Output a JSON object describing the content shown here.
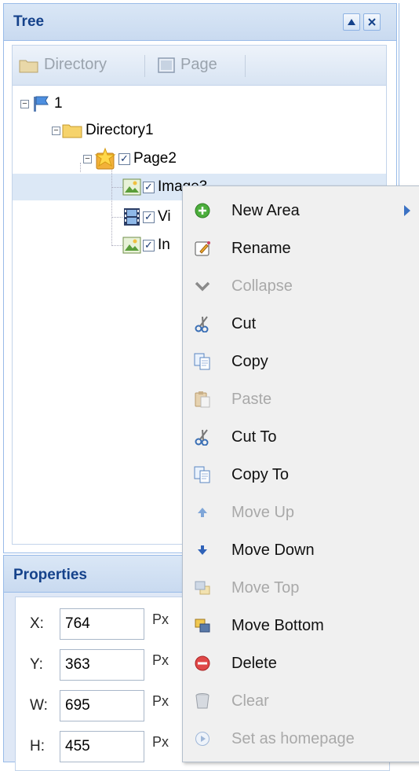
{
  "tree_panel": {
    "title": "Tree",
    "toolbar": {
      "directory_label": "Directory",
      "page_label": "Page"
    },
    "nodes": {
      "root": "1",
      "directory": "Directory1",
      "page": "Page2",
      "image1": "Image3",
      "video": "Vi",
      "image2": "In"
    }
  },
  "properties_panel": {
    "title": "Properties",
    "fields": [
      {
        "label": "X:",
        "value": "764",
        "unit": "Px"
      },
      {
        "label": "Y:",
        "value": "363",
        "unit": "Px"
      },
      {
        "label": "W:",
        "value": "695",
        "unit": "Px"
      },
      {
        "label": "H:",
        "value": "455",
        "unit": "Px"
      }
    ]
  },
  "context_menu": {
    "items": [
      {
        "label": "New Area",
        "icon": "add-green-icon",
        "enabled": true,
        "submenu": true
      },
      {
        "label": "Rename",
        "icon": "rename-icon",
        "enabled": true
      },
      {
        "label": "Collapse",
        "icon": "collapse-chevron-icon",
        "enabled": false
      },
      {
        "label": "Cut",
        "icon": "scissors-icon",
        "enabled": true
      },
      {
        "label": "Copy",
        "icon": "copy-icon",
        "enabled": true
      },
      {
        "label": "Paste",
        "icon": "paste-icon",
        "enabled": false
      },
      {
        "label": "Cut To",
        "icon": "scissors-icon",
        "enabled": true
      },
      {
        "label": "Copy To",
        "icon": "copy-icon",
        "enabled": true
      },
      {
        "label": "Move Up",
        "icon": "arrow-up-icon",
        "enabled": false
      },
      {
        "label": "Move Down",
        "icon": "arrow-down-icon",
        "enabled": true
      },
      {
        "label": "Move Top",
        "icon": "move-top-icon",
        "enabled": false
      },
      {
        "label": "Move Bottom",
        "icon": "move-bottom-icon",
        "enabled": true
      },
      {
        "label": "Delete",
        "icon": "delete-red-icon",
        "enabled": true
      },
      {
        "label": "Clear",
        "icon": "trash-can-icon",
        "enabled": false
      },
      {
        "label": "Set as homepage",
        "icon": "homepage-icon",
        "enabled": false
      }
    ]
  },
  "colors": {
    "header_text": "#15428b",
    "panel_border": "#99bbe8",
    "selected_row": "#dce8f6",
    "menu_bg": "#f0f0f0"
  }
}
